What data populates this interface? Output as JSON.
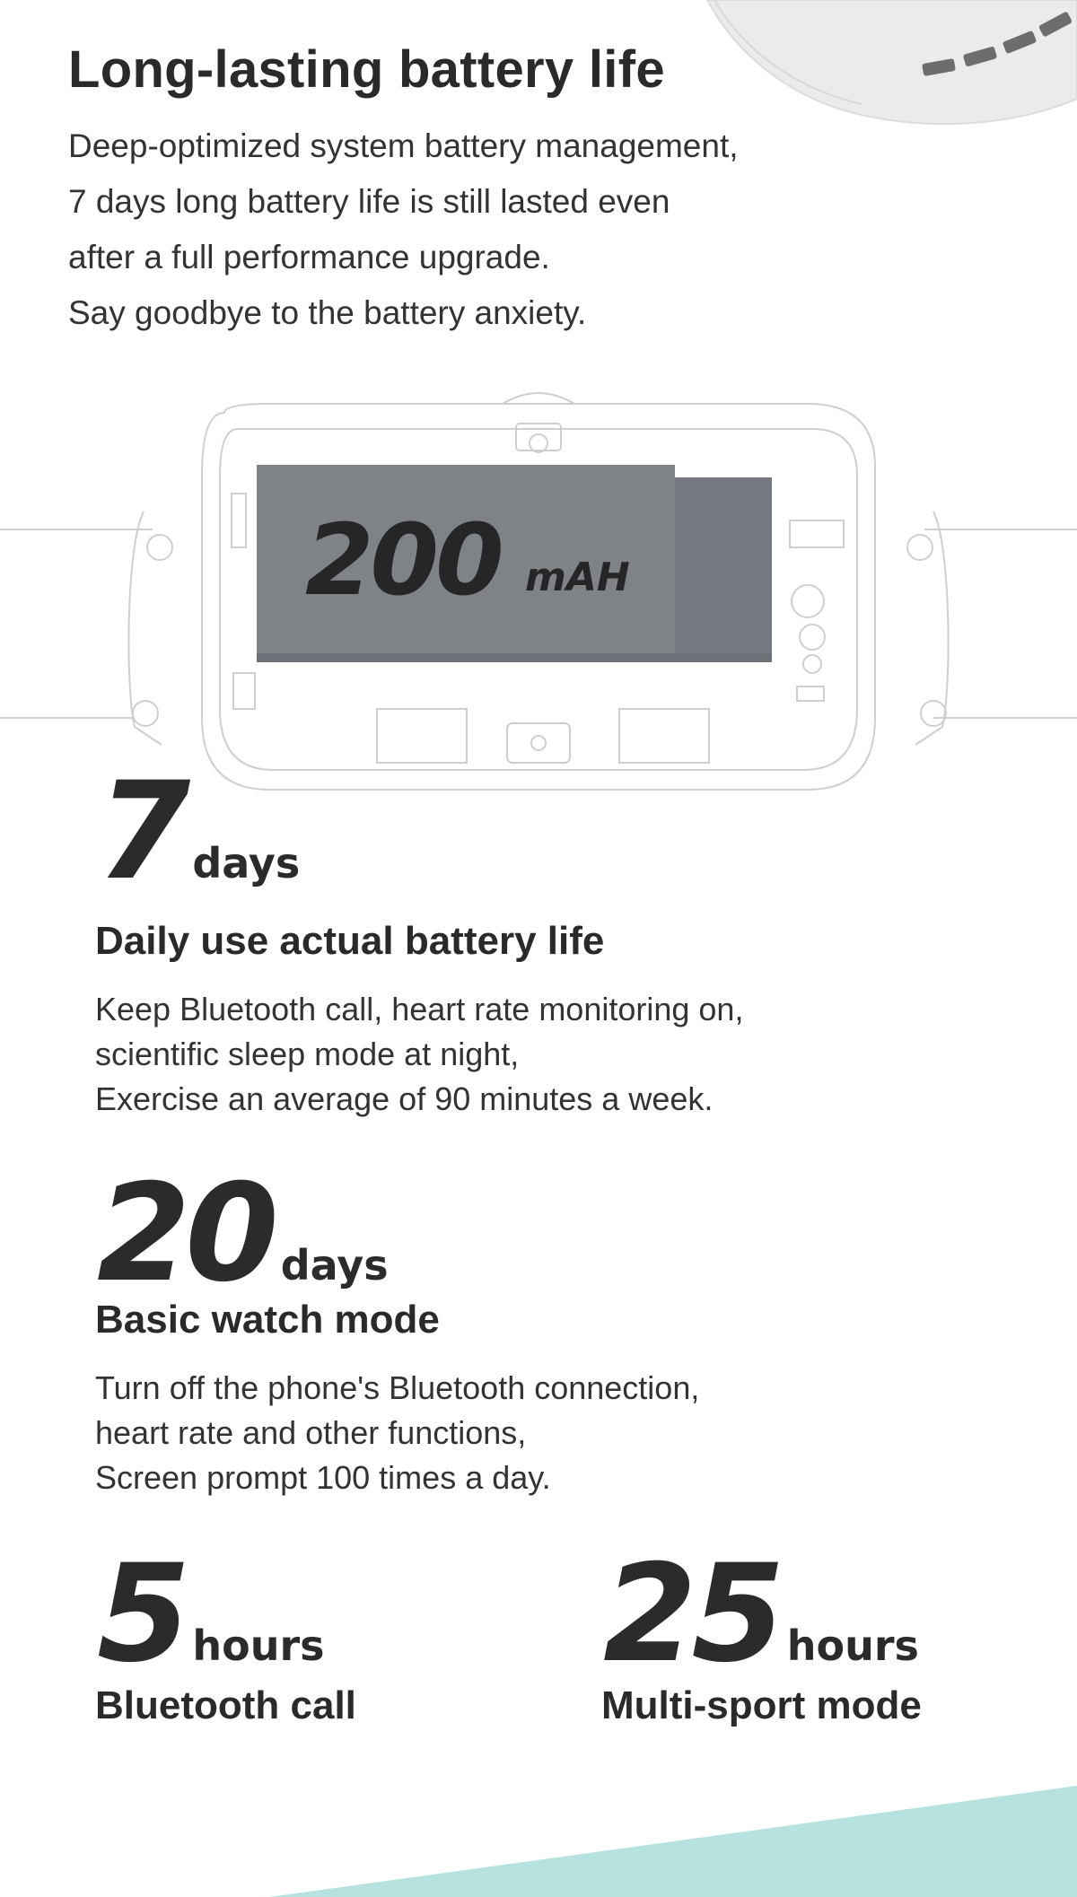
{
  "header": {
    "title": "Long-lasting battery life",
    "intro_lines": [
      "Deep-optimized system battery management,",
      "7 days long battery life is still lasted even",
      "after a full performance upgrade.",
      "Say goodbye to the battery anxiety."
    ]
  },
  "battery": {
    "capacity": "200",
    "unit": "mAH"
  },
  "stats": {
    "daily": {
      "value": "7",
      "unit": "days",
      "title": "Daily use actual battery life",
      "desc": [
        "Keep Bluetooth call, heart rate monitoring on,",
        "scientific sleep mode at night,",
        "Exercise an average of 90 minutes a week."
      ]
    },
    "basic": {
      "value": "20",
      "unit": "days",
      "title": "Basic watch mode",
      "desc": [
        "Turn off the phone's Bluetooth connection,",
        "heart rate and other functions,",
        "Screen prompt 100 times a day."
      ]
    },
    "call": {
      "value": "5",
      "unit": "hours",
      "title": "Bluetooth call"
    },
    "sport": {
      "value": "25",
      "unit": "hours",
      "title": "Multi-sport mode"
    }
  },
  "colors": {
    "battery_front": "#7f8287",
    "battery_side": "#757880",
    "accent_teal": "#b6e3e0",
    "strap": "#ebebeb",
    "text": "#2b2b2b"
  }
}
